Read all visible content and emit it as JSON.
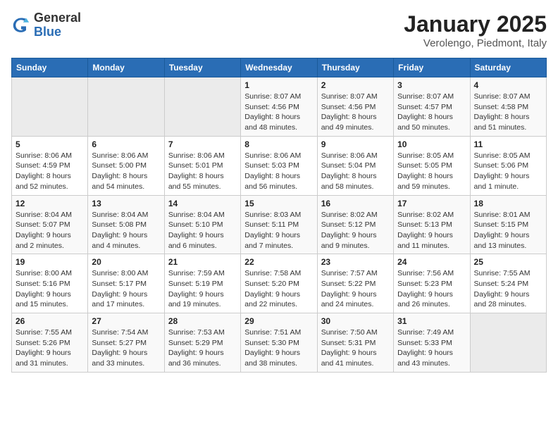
{
  "logo": {
    "general": "General",
    "blue": "Blue"
  },
  "title": "January 2025",
  "subtitle": "Verolengo, Piedmont, Italy",
  "weekdays": [
    "Sunday",
    "Monday",
    "Tuesday",
    "Wednesday",
    "Thursday",
    "Friday",
    "Saturday"
  ],
  "weeks": [
    [
      {
        "day": "",
        "info": ""
      },
      {
        "day": "",
        "info": ""
      },
      {
        "day": "",
        "info": ""
      },
      {
        "day": "1",
        "info": "Sunrise: 8:07 AM\nSunset: 4:56 PM\nDaylight: 8 hours\nand 48 minutes."
      },
      {
        "day": "2",
        "info": "Sunrise: 8:07 AM\nSunset: 4:56 PM\nDaylight: 8 hours\nand 49 minutes."
      },
      {
        "day": "3",
        "info": "Sunrise: 8:07 AM\nSunset: 4:57 PM\nDaylight: 8 hours\nand 50 minutes."
      },
      {
        "day": "4",
        "info": "Sunrise: 8:07 AM\nSunset: 4:58 PM\nDaylight: 8 hours\nand 51 minutes."
      }
    ],
    [
      {
        "day": "5",
        "info": "Sunrise: 8:06 AM\nSunset: 4:59 PM\nDaylight: 8 hours\nand 52 minutes."
      },
      {
        "day": "6",
        "info": "Sunrise: 8:06 AM\nSunset: 5:00 PM\nDaylight: 8 hours\nand 54 minutes."
      },
      {
        "day": "7",
        "info": "Sunrise: 8:06 AM\nSunset: 5:01 PM\nDaylight: 8 hours\nand 55 minutes."
      },
      {
        "day": "8",
        "info": "Sunrise: 8:06 AM\nSunset: 5:03 PM\nDaylight: 8 hours\nand 56 minutes."
      },
      {
        "day": "9",
        "info": "Sunrise: 8:06 AM\nSunset: 5:04 PM\nDaylight: 8 hours\nand 58 minutes."
      },
      {
        "day": "10",
        "info": "Sunrise: 8:05 AM\nSunset: 5:05 PM\nDaylight: 8 hours\nand 59 minutes."
      },
      {
        "day": "11",
        "info": "Sunrise: 8:05 AM\nSunset: 5:06 PM\nDaylight: 9 hours\nand 1 minute."
      }
    ],
    [
      {
        "day": "12",
        "info": "Sunrise: 8:04 AM\nSunset: 5:07 PM\nDaylight: 9 hours\nand 2 minutes."
      },
      {
        "day": "13",
        "info": "Sunrise: 8:04 AM\nSunset: 5:08 PM\nDaylight: 9 hours\nand 4 minutes."
      },
      {
        "day": "14",
        "info": "Sunrise: 8:04 AM\nSunset: 5:10 PM\nDaylight: 9 hours\nand 6 minutes."
      },
      {
        "day": "15",
        "info": "Sunrise: 8:03 AM\nSunset: 5:11 PM\nDaylight: 9 hours\nand 7 minutes."
      },
      {
        "day": "16",
        "info": "Sunrise: 8:02 AM\nSunset: 5:12 PM\nDaylight: 9 hours\nand 9 minutes."
      },
      {
        "day": "17",
        "info": "Sunrise: 8:02 AM\nSunset: 5:13 PM\nDaylight: 9 hours\nand 11 minutes."
      },
      {
        "day": "18",
        "info": "Sunrise: 8:01 AM\nSunset: 5:15 PM\nDaylight: 9 hours\nand 13 minutes."
      }
    ],
    [
      {
        "day": "19",
        "info": "Sunrise: 8:00 AM\nSunset: 5:16 PM\nDaylight: 9 hours\nand 15 minutes."
      },
      {
        "day": "20",
        "info": "Sunrise: 8:00 AM\nSunset: 5:17 PM\nDaylight: 9 hours\nand 17 minutes."
      },
      {
        "day": "21",
        "info": "Sunrise: 7:59 AM\nSunset: 5:19 PM\nDaylight: 9 hours\nand 19 minutes."
      },
      {
        "day": "22",
        "info": "Sunrise: 7:58 AM\nSunset: 5:20 PM\nDaylight: 9 hours\nand 22 minutes."
      },
      {
        "day": "23",
        "info": "Sunrise: 7:57 AM\nSunset: 5:22 PM\nDaylight: 9 hours\nand 24 minutes."
      },
      {
        "day": "24",
        "info": "Sunrise: 7:56 AM\nSunset: 5:23 PM\nDaylight: 9 hours\nand 26 minutes."
      },
      {
        "day": "25",
        "info": "Sunrise: 7:55 AM\nSunset: 5:24 PM\nDaylight: 9 hours\nand 28 minutes."
      }
    ],
    [
      {
        "day": "26",
        "info": "Sunrise: 7:55 AM\nSunset: 5:26 PM\nDaylight: 9 hours\nand 31 minutes."
      },
      {
        "day": "27",
        "info": "Sunrise: 7:54 AM\nSunset: 5:27 PM\nDaylight: 9 hours\nand 33 minutes."
      },
      {
        "day": "28",
        "info": "Sunrise: 7:53 AM\nSunset: 5:29 PM\nDaylight: 9 hours\nand 36 minutes."
      },
      {
        "day": "29",
        "info": "Sunrise: 7:51 AM\nSunset: 5:30 PM\nDaylight: 9 hours\nand 38 minutes."
      },
      {
        "day": "30",
        "info": "Sunrise: 7:50 AM\nSunset: 5:31 PM\nDaylight: 9 hours\nand 41 minutes."
      },
      {
        "day": "31",
        "info": "Sunrise: 7:49 AM\nSunset: 5:33 PM\nDaylight: 9 hours\nand 43 minutes."
      },
      {
        "day": "",
        "info": ""
      }
    ]
  ]
}
